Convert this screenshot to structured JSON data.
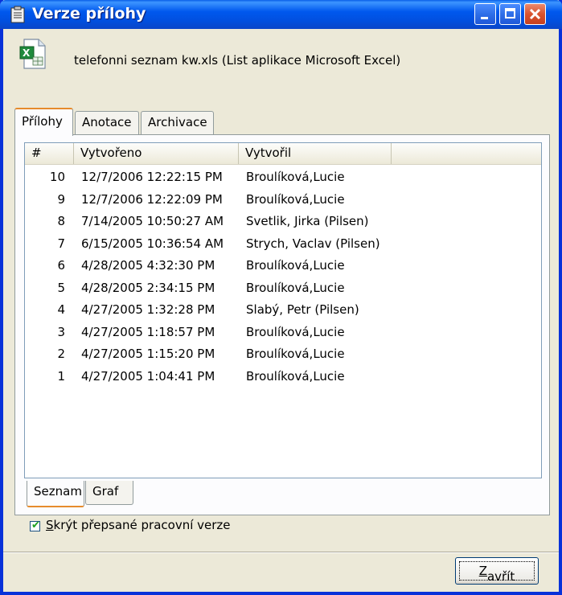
{
  "window": {
    "title": "Verze přílohy"
  },
  "file": {
    "label": "telefonni seznam kw.xls (List aplikace Microsoft Excel)",
    "icon": "excel-file-icon"
  },
  "tabs": [
    {
      "label": "Přílohy",
      "active": true
    },
    {
      "label": "Anotace",
      "active": false
    },
    {
      "label": "Archivace",
      "active": false
    }
  ],
  "table": {
    "columns": [
      "#",
      "Vytvořeno",
      "Vytvořil",
      ""
    ],
    "rows": [
      {
        "num": "10",
        "created": "12/7/2006 12:22:15 PM",
        "by": "Broulíková,Lucie"
      },
      {
        "num": "9",
        "created": "12/7/2006 12:22:09 PM",
        "by": "Broulíková,Lucie"
      },
      {
        "num": "8",
        "created": "7/14/2005 10:50:27 AM",
        "by": "Svetlik, Jirka (Pilsen)"
      },
      {
        "num": "7",
        "created": "6/15/2005 10:36:54 AM",
        "by": "Strych, Vaclav (Pilsen)"
      },
      {
        "num": "6",
        "created": "4/28/2005 4:32:30 PM",
        "by": "Broulíková,Lucie"
      },
      {
        "num": "5",
        "created": "4/28/2005 2:34:15 PM",
        "by": "Broulíková,Lucie"
      },
      {
        "num": "4",
        "created": "4/27/2005 1:32:28 PM",
        "by": "Slabý, Petr (Pilsen)"
      },
      {
        "num": "3",
        "created": "4/27/2005 1:18:57 PM",
        "by": "Broulíková,Lucie"
      },
      {
        "num": "2",
        "created": "4/27/2005 1:15:20 PM",
        "by": "Broulíková,Lucie"
      },
      {
        "num": "1",
        "created": "4/27/2005 1:04:41 PM",
        "by": "Broulíková,Lucie"
      }
    ]
  },
  "subtabs": [
    {
      "label": "Seznam",
      "active": true
    },
    {
      "label": "Graf",
      "active": false
    }
  ],
  "checkbox": {
    "accel": "S",
    "rest": "krýt přepsané pracovní verze",
    "checked": true
  },
  "buttons": {
    "close_accel": "Z",
    "close_rest": "avřít"
  },
  "colors": {
    "title_blue": "#0058ee",
    "tab_accent": "#e68b2c",
    "dialog_bg": "#ece9d8"
  }
}
